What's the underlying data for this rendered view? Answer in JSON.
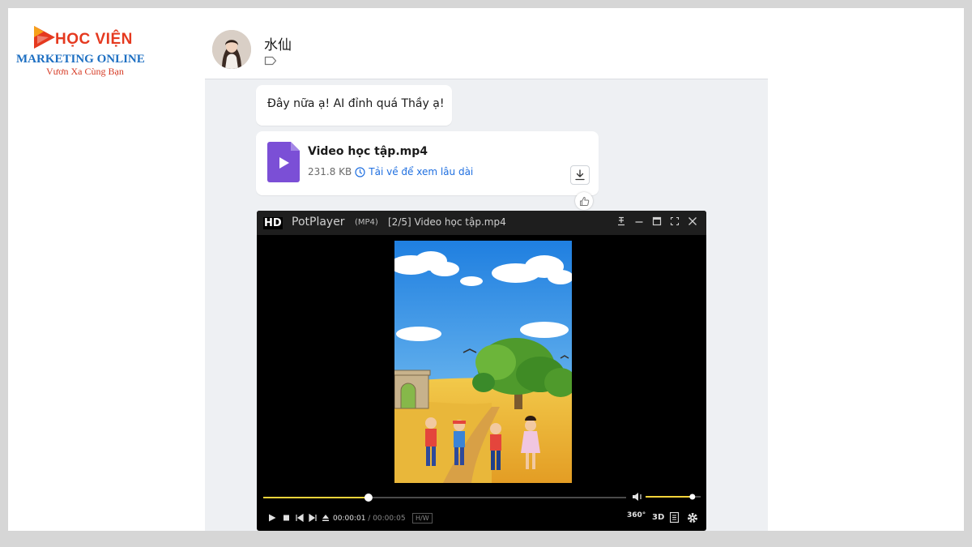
{
  "logo": {
    "title": "HỌC VIỆN",
    "subtitle": "MARKETING ONLINE",
    "slogan": "Vươn Xa Cùng Bạn",
    "colors": {
      "red": "#e5391f",
      "blue": "#1d6fc2"
    }
  },
  "conversation": {
    "sender_name": "水仙",
    "tag_icon": "tag-outline-icon"
  },
  "messages": {
    "text": "Đây nữa ạ! AI đỉnh quá Thầy ạ!",
    "file": {
      "name": "Video học tập.mp4",
      "size": "231.8 KB",
      "action_text": "Tải về để xem lâu dài",
      "file_icon": "video-file-icon",
      "accent_color": "#7c4dff",
      "link_color": "#1f6fe0"
    }
  },
  "player": {
    "hd_badge": "HD",
    "app_name": "PotPlayer",
    "format": "(MP4)",
    "window_title": "[2/5] Video học tập.mp4",
    "time_current": "00:00:01",
    "time_total": "/ 00:00:05",
    "hw_label": "H/W",
    "badge_360": "360°",
    "badge_3d": "3D",
    "progress_fraction": 0.29,
    "volume_fraction": 0.85,
    "accent_color": "#f3d33a"
  }
}
